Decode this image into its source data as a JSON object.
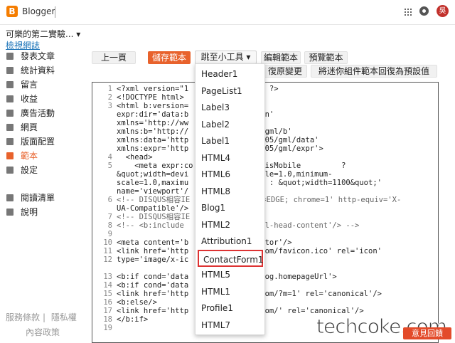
{
  "app": {
    "brand": "Blogger",
    "avatar_letter": "吳"
  },
  "sidebar": {
    "blog_title": "可樂的第二實驗...",
    "view_blog": "檢視網誌",
    "items": [
      {
        "label": "發表文章",
        "icon": "posts-icon"
      },
      {
        "label": "統計資料",
        "icon": "stats-icon"
      },
      {
        "label": "留言",
        "icon": "comments-icon"
      },
      {
        "label": "收益",
        "icon": "earnings-icon"
      },
      {
        "label": "廣告活動",
        "icon": "campaigns-icon"
      },
      {
        "label": "網頁",
        "icon": "pages-icon"
      },
      {
        "label": "版面配置",
        "icon": "layout-icon"
      },
      {
        "label": "範本",
        "icon": "theme-icon",
        "active": true
      },
      {
        "label": "設定",
        "icon": "settings-icon"
      },
      {
        "label": "閱讀清單",
        "icon": "reading-list-icon"
      },
      {
        "label": "說明",
        "icon": "help-icon"
      }
    ],
    "footer_terms": "服務條款",
    "footer_privacy": "隱私權",
    "footer_policy": "內容政策"
  },
  "toolbar": {
    "back": "上一頁",
    "save": "儲存範本",
    "jump": "跳至小工具",
    "edit": "編輯範本",
    "preview": "預覽範本",
    "revert": "復原變更",
    "reset": "將迷你組件範本回復為預設值"
  },
  "dropdown": {
    "items": [
      "Header1",
      "PageList1",
      "Label3",
      "Label2",
      "Label1",
      "HTML4",
      "HTML6",
      "HTML8",
      "Blog1",
      "HTML2",
      "Attribution1",
      "ContactForm1",
      "HTML5",
      "HTML1",
      "Profile1",
      "HTML7"
    ],
    "selected_index": 11
  },
  "code_lines": [
    "1",
    "2",
    "3",
    "",
    "",
    "",
    "",
    "",
    "4",
    "5",
    "",
    "",
    "",
    "6",
    "",
    "7",
    "8",
    "9",
    "10",
    "11",
    "12",
    "",
    "13",
    "14",
    "15",
    "16",
    "17",
    "18",
    "19"
  ],
  "code_text": [
    "<?xml version=\"1            TF-8\" ?>",
    "<!DOCTYPE html>",
    "<html b:version=",
    "expr:dir='data:b            ection'",
    "xmlns='http://ww            html'",
    "xmlns:b='http://            2005/gml/b'",
    "xmlns:data='http            om/2005/gml/data'",
    "xmlns:expr='http            om/2005/gml/expr'>",
    "  <head>",
    "    <meta expr:co            log.isMobile         ?",
    "&quot;width=devi            l-scale=1.0,minimum-",
    "scale=1.0,maximu                  : &quot;width=1100&quot;'",
    "name='viewport'/",
    "<!-- DISQUS相容IE            ; IE=EDGE; chrome=1' http-equiv='X-",
    "UA-Compatible'/>",
    "<!-- DISQUS相容IE",
    "<!-- <b:include             e='all-head-content'/> -->",
    "",
    "<meta content='b            enerator'/>",
    "<link href='http            oke.com/favicon.ico' rel='icon'",
    "type='image/x-ic",
    "",
    "<b:if cond='data            ta:blog.homepageUrl'>",
    "<b:if cond='data",
    "<link href='http            oke.com/?m=1' rel='canonical'/>",
    "<b:else/>",
    "<link href='http            oke.com/' rel='canonical'/>",
    "</b:if>",
    ""
  ],
  "watermark": "techcoke.com",
  "feedback": "意見回饋"
}
